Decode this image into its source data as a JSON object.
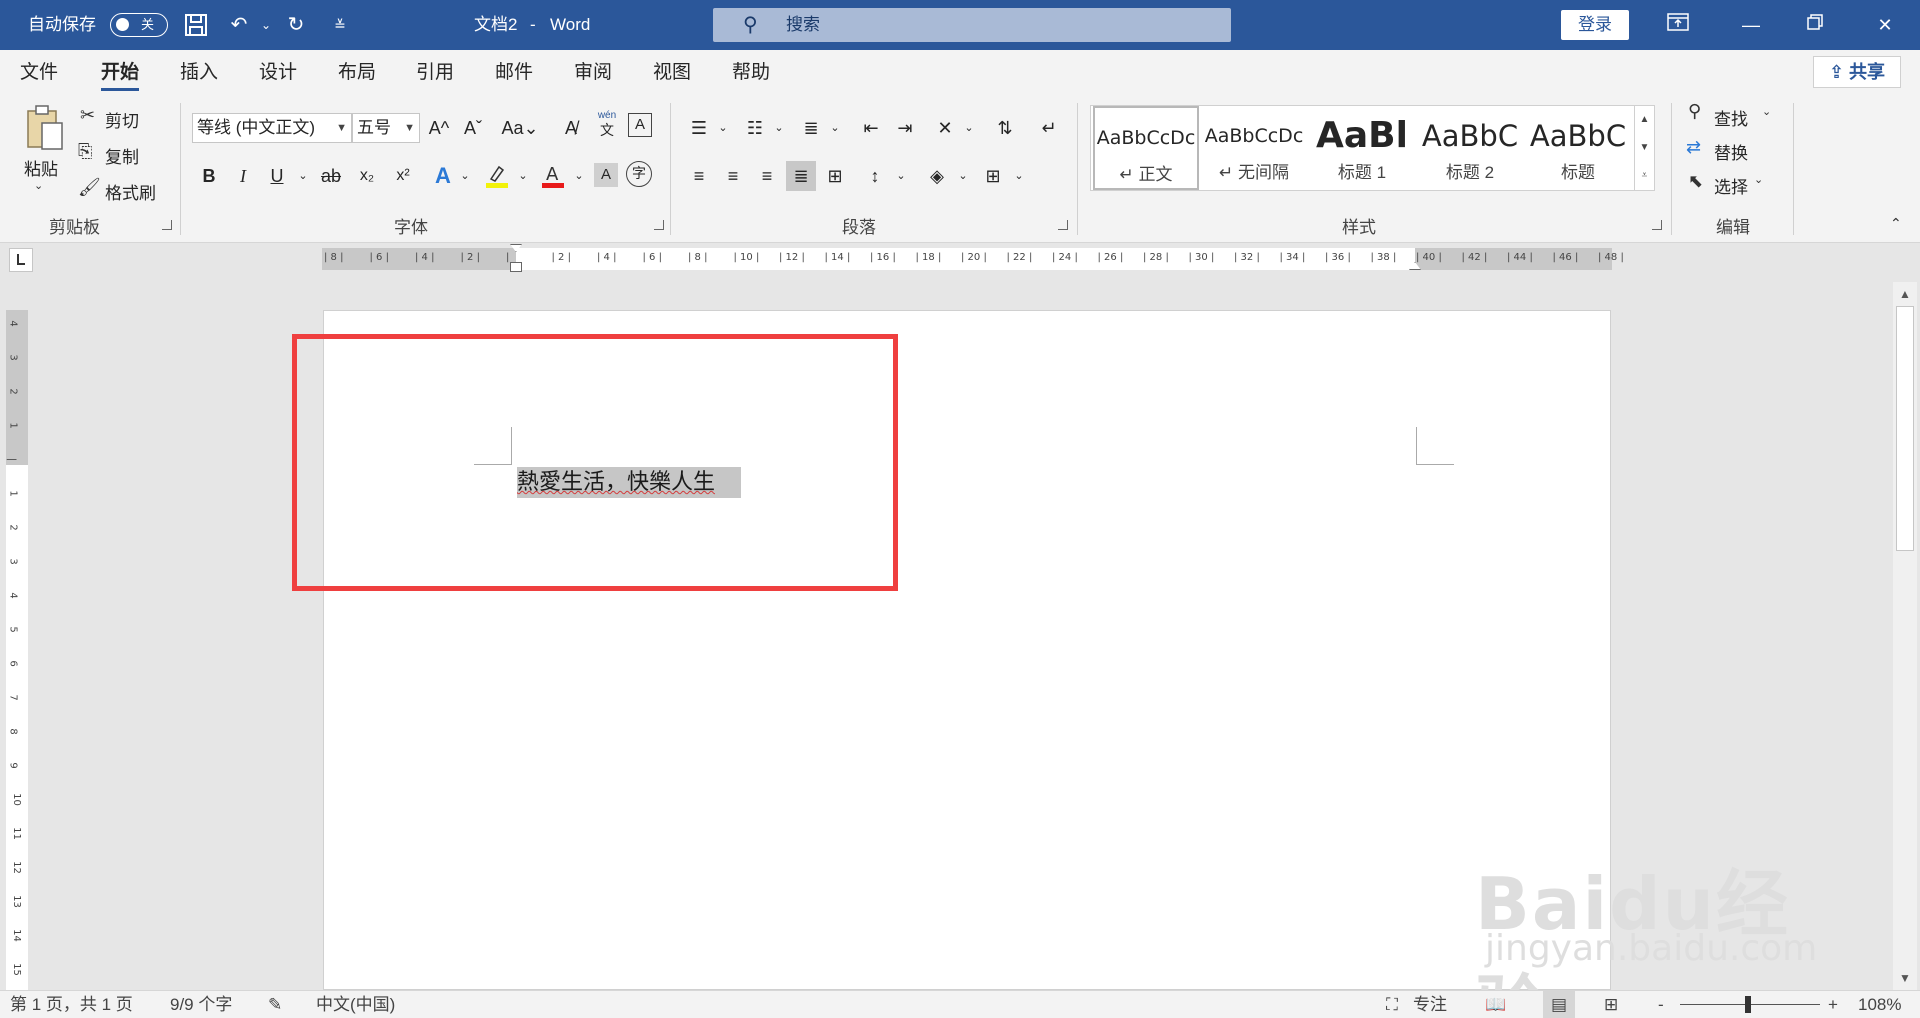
{
  "titlebar": {
    "autosave_label": "自动保存",
    "autosave_state": "关",
    "doc_title": "文档2",
    "dash": "-",
    "app_name": "Word",
    "search_placeholder": "搜索",
    "login_label": "登录"
  },
  "menu": {
    "tabs": [
      "文件",
      "开始",
      "插入",
      "设计",
      "布局",
      "引用",
      "邮件",
      "审阅",
      "视图",
      "帮助"
    ],
    "active_tab": "开始",
    "share_label": "共享"
  },
  "ribbon": {
    "clipboard": {
      "paste_label": "粘贴",
      "cut_label": "剪切",
      "copy_label": "复制",
      "format_painter_label": "格式刷",
      "group_label": "剪贴板"
    },
    "font": {
      "font_name": "等线 (中文正文)",
      "font_size": "五号",
      "bold": "B",
      "italic": "I",
      "underline": "U",
      "strikethrough": "ab",
      "subscript": "x₂",
      "superscript": "x²",
      "change_case": "Aa",
      "grow": "A^",
      "shrink": "Aˇ",
      "phonetic_top": "wén",
      "phonetic_bottom": "文",
      "char_border": "A",
      "char_shading": "A",
      "enclose": "字",
      "group_label": "字体"
    },
    "paragraph": {
      "group_label": "段落"
    },
    "styles": {
      "items": [
        {
          "preview": "AaBbCcDc",
          "name": "↵ 正文"
        },
        {
          "preview": "AaBbCcDc",
          "name": "↵ 无间隔"
        },
        {
          "preview": "AaBl",
          "name": "标题 1"
        },
        {
          "preview": "AaBbC",
          "name": "标题 2"
        },
        {
          "preview": "AaBbC",
          "name": "标题"
        }
      ],
      "group_label": "样式"
    },
    "editing": {
      "find_label": "查找",
      "replace_label": "替换",
      "select_label": "选择",
      "group_label": "编辑"
    }
  },
  "ruler": {
    "h_ticks": [
      "8",
      "6",
      "4",
      "2",
      "",
      "2",
      "4",
      "6",
      "8",
      "10",
      "12",
      "14",
      "16",
      "18",
      "20",
      "22",
      "24",
      "26",
      "28",
      "30",
      "32",
      "34",
      "36",
      "38",
      "40",
      "42",
      "44",
      "46",
      "48"
    ],
    "v_ticks": [
      "4",
      "3",
      "2",
      "1",
      "",
      "1",
      "2",
      "3",
      "4",
      "5",
      "6",
      "7",
      "8",
      "9",
      "10",
      "11",
      "12",
      "13",
      "14",
      "15"
    ]
  },
  "document": {
    "text": "熱愛生活，快樂人生"
  },
  "statusbar": {
    "page": "第 1 页，共 1 页",
    "words": "9/9 个字",
    "language": "中文(中国)",
    "focus_label": "专注",
    "zoom_minus": "-",
    "zoom_plus": "+",
    "zoom_level": "108%"
  },
  "watermark": {
    "brand": "Baidu经验",
    "url": "jingyan.baidu.com"
  },
  "colors": {
    "titlebar": "#2b579a",
    "highlight_box": "#ef3f3f",
    "selection": "#c6c6c6"
  }
}
